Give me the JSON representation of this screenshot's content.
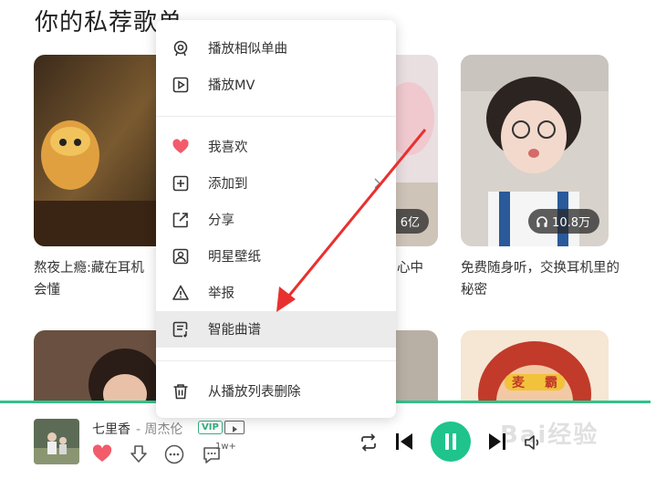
{
  "section_title": "你的私荐歌单",
  "cards": [
    {
      "title_line1": "熬夜上瘾:藏在耳机",
      "title_line2": "会懂",
      "play_count": ""
    },
    {
      "title_line1": "心中",
      "title_line2": "",
      "play_count": "6亿"
    },
    {
      "title_line1": "免费随身听，交换耳机里的",
      "title_line2": "秘密",
      "play_count": "10.8万"
    }
  ],
  "menu": {
    "items": [
      {
        "label": "播放相似单曲",
        "icon": "similar-songs-icon"
      },
      {
        "label": "播放MV",
        "icon": "mv-play-icon"
      },
      {
        "label": "我喜欢",
        "icon": "heart-icon"
      },
      {
        "label": "添加到",
        "icon": "add-icon"
      },
      {
        "label": "分享",
        "icon": "share-icon"
      },
      {
        "label": "明星壁纸",
        "icon": "wallpaper-icon"
      },
      {
        "label": "举报",
        "icon": "report-icon"
      },
      {
        "label": "智能曲谱",
        "icon": "sheet-music-icon"
      },
      {
        "label": "从播放列表删除",
        "icon": "trash-icon"
      }
    ],
    "highlighted": "智能曲谱"
  },
  "player": {
    "song_title": "七里香",
    "artist": "- 周杰伦",
    "vip_tag": "VIP",
    "comment_count": "1w+"
  },
  "watermark": "Bai经验",
  "colors": {
    "accent": "#1ec48c",
    "heart": "#f25b6a",
    "annotation_arrow": "#e8312f"
  }
}
